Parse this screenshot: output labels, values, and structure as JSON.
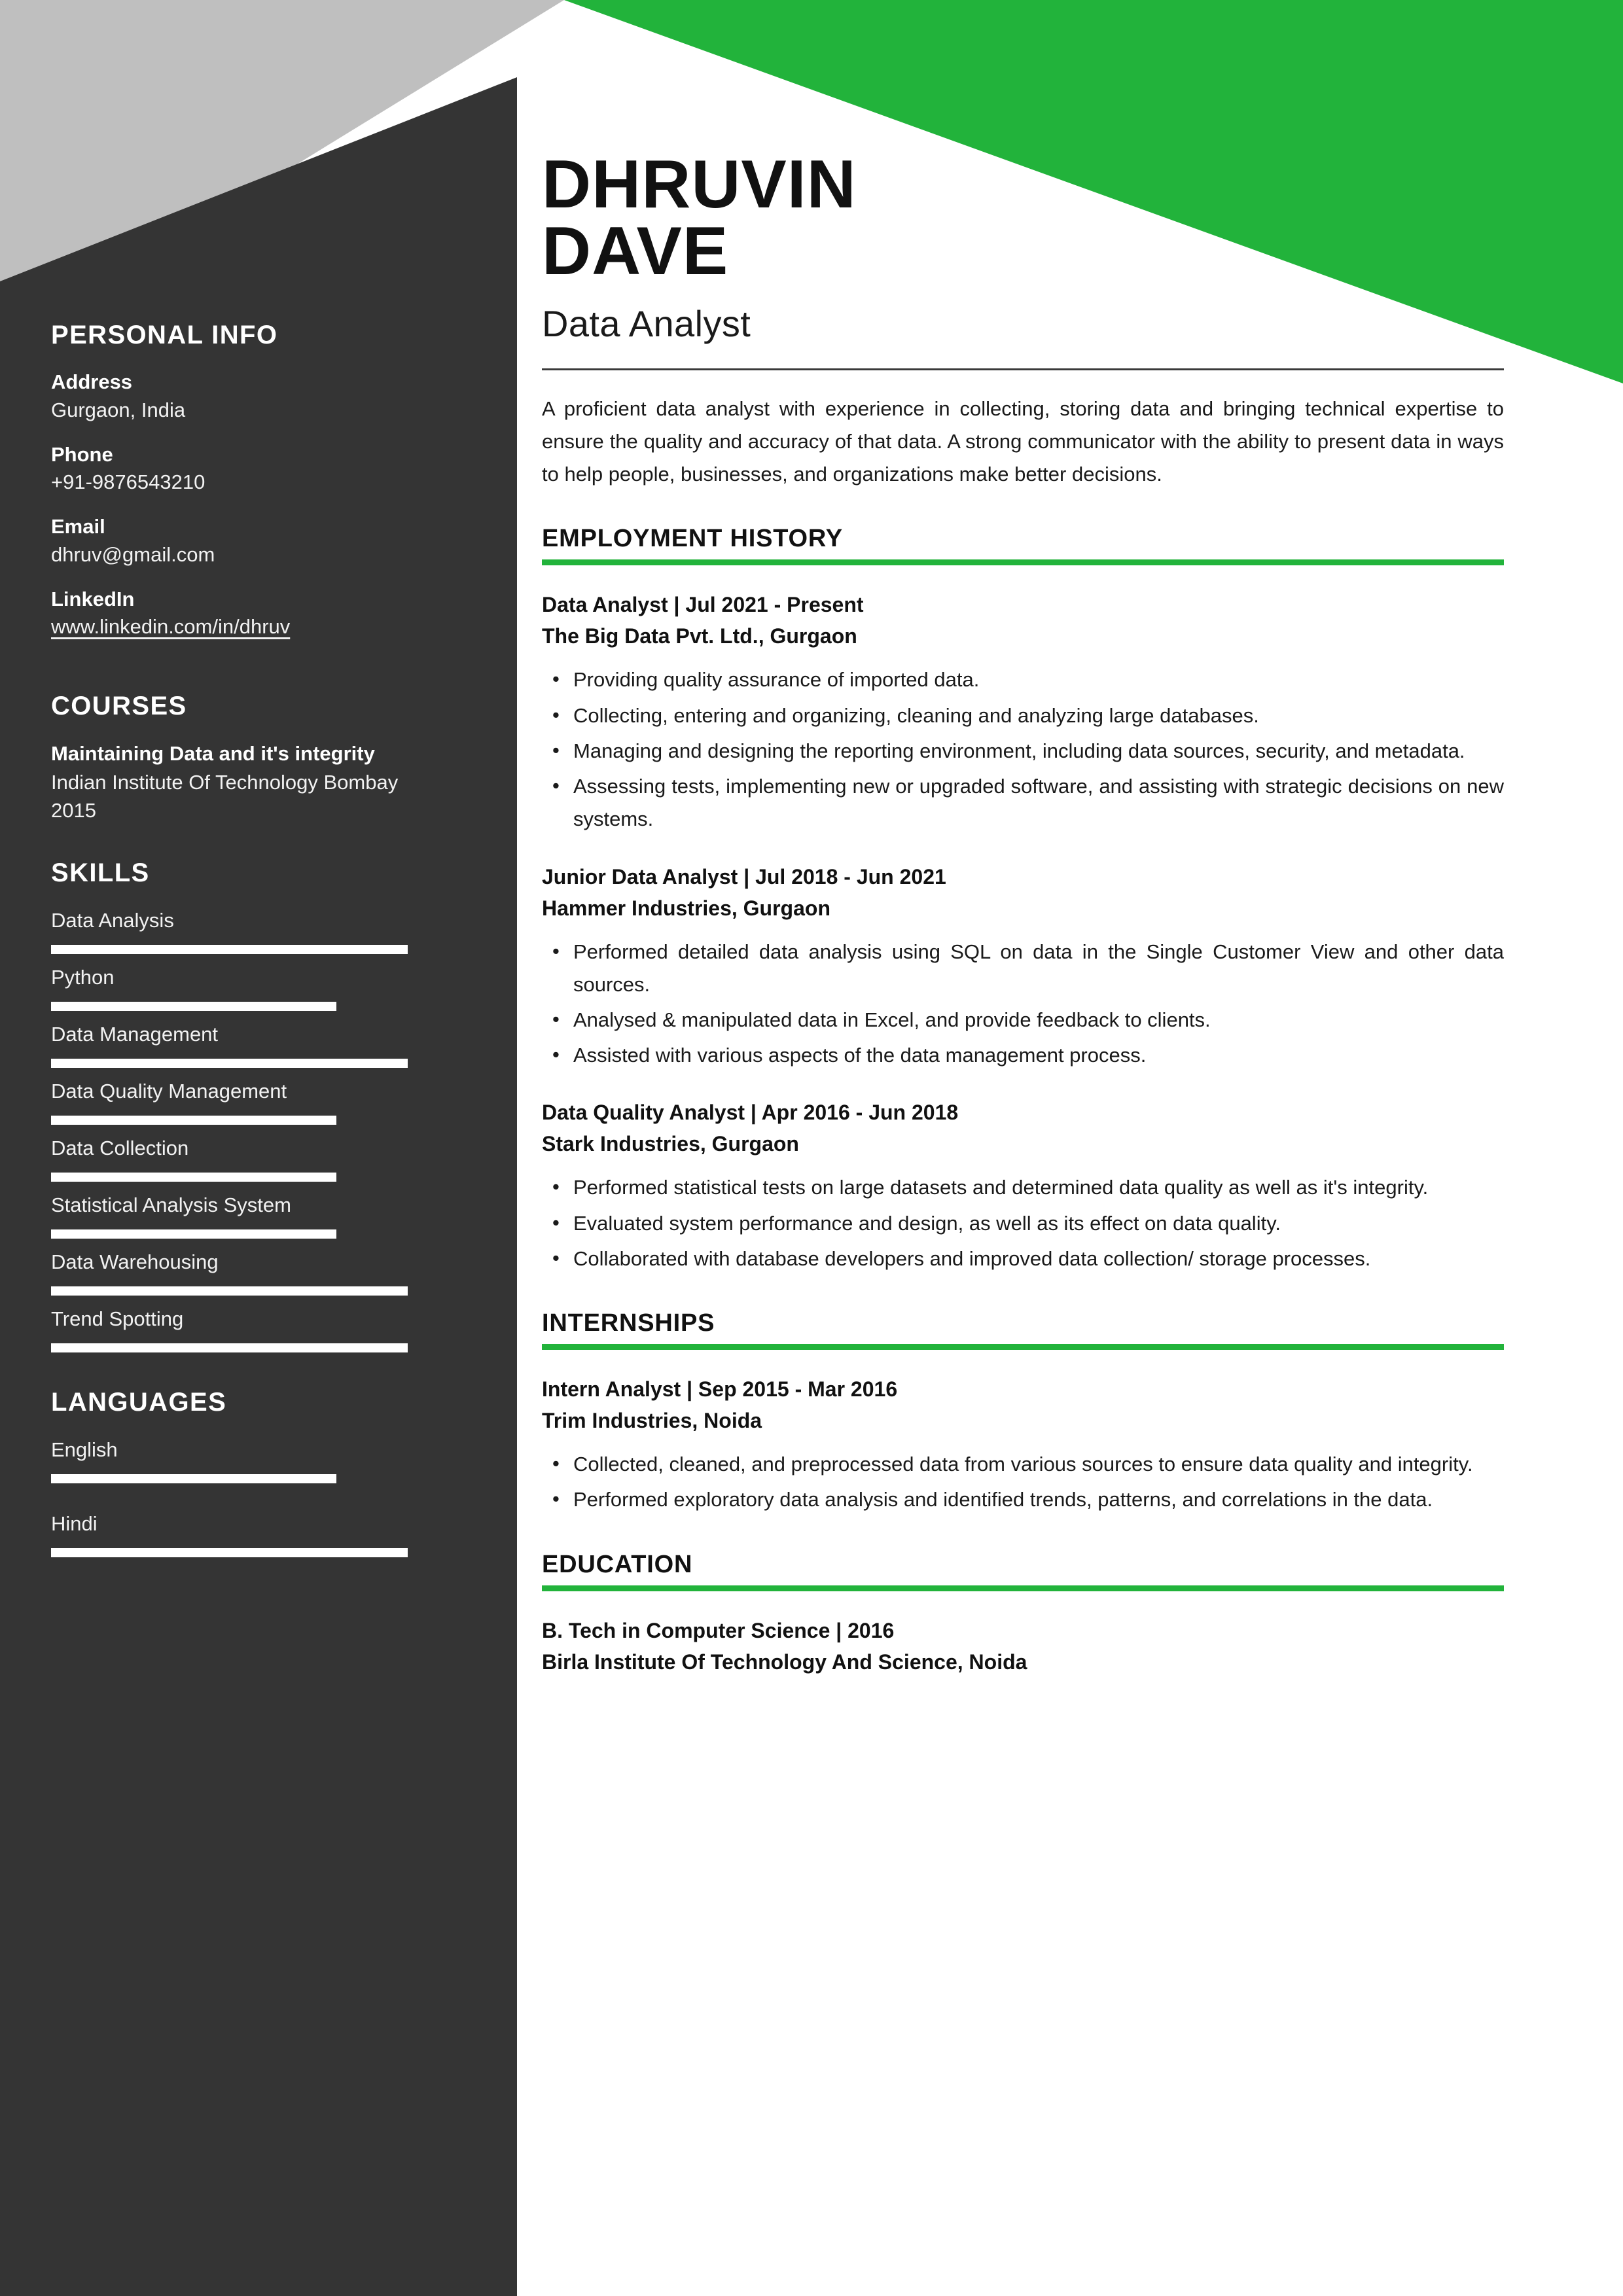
{
  "colors": {
    "accent_green": "#22b33b",
    "sidebar_dark": "#343434",
    "corner_gray": "#bfbfbf",
    "text_dark": "#1a1a1a"
  },
  "header": {
    "first_name": "DHRUVIN",
    "last_name": "DAVE",
    "job_title": "Data Analyst"
  },
  "summary": "A proficient data analyst with experience in collecting, storing data and bringing technical expertise to ensure the quality and accuracy of that data. A strong communicator with the ability to present data in ways to help people, businesses, and organizations make better decisions.",
  "sidebar": {
    "personal_info": {
      "heading": "PERSONAL INFO",
      "fields": [
        {
          "label": "Address",
          "value": "Gurgaon, India",
          "is_link": false
        },
        {
          "label": "Phone",
          "value": "+91-9876543210",
          "is_link": false
        },
        {
          "label": "Email",
          "value": "dhruv@gmail.com",
          "is_link": false
        },
        {
          "label": "LinkedIn",
          "value": "www.linkedin.com/in/dhruv",
          "is_link": true
        }
      ]
    },
    "courses": {
      "heading": "COURSES",
      "items": [
        {
          "title": "Maintaining Data and it's integrity",
          "institution": "Indian Institute Of Technology Bombay",
          "year": "2015"
        }
      ]
    },
    "skills": {
      "heading": "SKILLS",
      "items": [
        {
          "name": "Data Analysis",
          "level": 100
        },
        {
          "name": "Python",
          "level": 80
        },
        {
          "name": "Data Management",
          "level": 100
        },
        {
          "name": "Data Quality Management",
          "level": 80
        },
        {
          "name": "Data Collection",
          "level": 80
        },
        {
          "name": "Statistical Analysis System",
          "level": 80
        },
        {
          "name": "Data Warehousing",
          "level": 100
        },
        {
          "name": "Trend Spotting",
          "level": 100
        }
      ]
    },
    "languages": {
      "heading": "LANGUAGES",
      "items": [
        {
          "name": "English",
          "level": 80
        },
        {
          "name": "Hindi",
          "level": 100
        }
      ]
    }
  },
  "employment": {
    "heading": "EMPLOYMENT HISTORY",
    "jobs": [
      {
        "title": "Data Analyst | Jul 2021 - Present",
        "company": "The Big Data Pvt. Ltd., Gurgaon",
        "bullets": [
          "Providing quality assurance of imported data.",
          "Collecting, entering and organizing, cleaning and analyzing large databases.",
          "Managing and designing the reporting environment, including data sources, security, and metadata.",
          "Assessing tests, implementing new or upgraded software, and assisting with strategic decisions on new systems."
        ]
      },
      {
        "title": "Junior Data Analyst | Jul 2018 - Jun 2021",
        "company": "Hammer Industries, Gurgaon",
        "bullets": [
          "Performed detailed data analysis using SQL on data in the Single Customer View and other data sources.",
          "Analysed & manipulated data in Excel, and provide feedback to clients.",
          "Assisted with various aspects of the data management process."
        ]
      },
      {
        "title": "Data Quality Analyst | Apr 2016 - Jun 2018",
        "company": "Stark Industries, Gurgaon",
        "bullets": [
          "Performed statistical tests on large datasets and determined data quality as well as it's integrity.",
          "Evaluated system performance and design, as well as its effect on data quality.",
          "Collaborated with database developers and improved data collection/ storage processes."
        ]
      }
    ]
  },
  "internships": {
    "heading": "INTERNSHIPS",
    "jobs": [
      {
        "title": "Intern Analyst | Sep 2015 - Mar 2016",
        "company": "Trim Industries, Noida",
        "bullets": [
          "Collected, cleaned, and preprocessed data from various sources to ensure data quality and integrity.",
          "Performed exploratory data analysis and identified trends, patterns, and correlations in the data."
        ]
      }
    ]
  },
  "education": {
    "heading": "EDUCATION",
    "items": [
      {
        "degree": "B. Tech in Computer Science | 2016",
        "school": "Birla Institute Of Technology And Science, Noida"
      }
    ]
  }
}
